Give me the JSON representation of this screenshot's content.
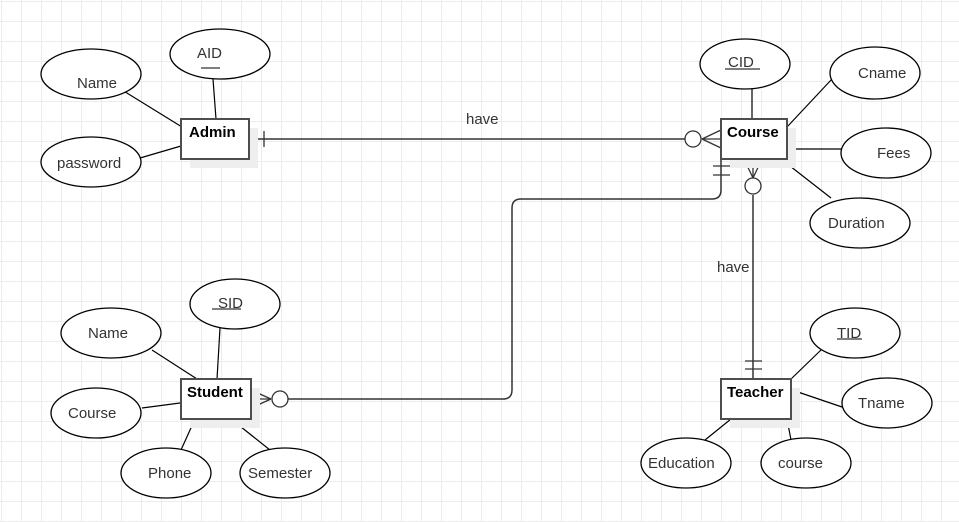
{
  "diagram": {
    "type": "ER diagram",
    "entities": {
      "admin": {
        "name": "Admin"
      },
      "course": {
        "name": "Course"
      },
      "student": {
        "name": "Student"
      },
      "teacher": {
        "name": "Teacher"
      }
    },
    "attributes": {
      "admin": [
        {
          "label": "AID",
          "key": true
        },
        {
          "label": "Name",
          "key": false
        },
        {
          "label": "password",
          "key": false
        }
      ],
      "course": [
        {
          "label": "CID",
          "key": true
        },
        {
          "label": "Cname",
          "key": false
        },
        {
          "label": "Fees",
          "key": false
        },
        {
          "label": "Duration",
          "key": false
        }
      ],
      "student": [
        {
          "label": "SID",
          "key": true
        },
        {
          "label": "Name",
          "key": false
        },
        {
          "label": "Course",
          "key": false
        },
        {
          "label": "Phone",
          "key": false
        },
        {
          "label": "Semester",
          "key": false
        }
      ],
      "teacher": [
        {
          "label": "TID",
          "key": true
        },
        {
          "label": "Tname",
          "key": false
        },
        {
          "label": "Education",
          "key": false
        },
        {
          "label": "course",
          "key": false
        }
      ]
    },
    "relationships": [
      {
        "label": "have",
        "from": "Admin",
        "from_cardinality": "one and only one",
        "to": "Course",
        "to_cardinality": "zero or many"
      },
      {
        "label": "have",
        "from": "Course",
        "from_cardinality": "zero or many",
        "to": "Teacher",
        "to_cardinality": "one and only one"
      },
      {
        "label": "",
        "from": "Course",
        "from_cardinality": "one and only one",
        "to": "Student",
        "to_cardinality": "zero or many"
      }
    ]
  }
}
